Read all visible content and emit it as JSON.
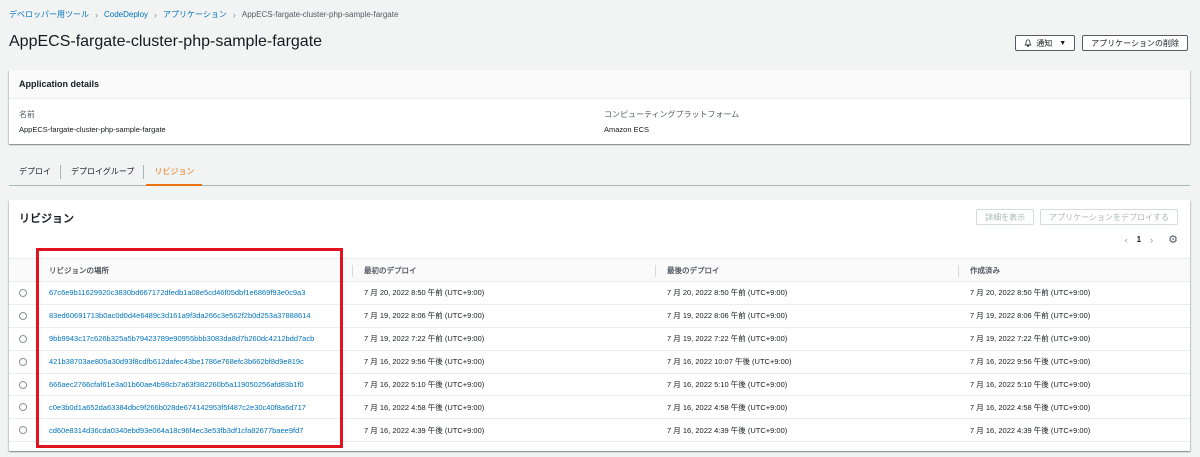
{
  "breadcrumb": {
    "items": [
      "デベロッパー用ツール",
      "CodeDeploy",
      "アプリケーション"
    ],
    "current": "AppECS-fargate-cluster-php-sample-fargate"
  },
  "page": {
    "title": "AppECS-fargate-cluster-php-sample-fargate",
    "notify_label": "通知",
    "delete_label": "アプリケーションの削除"
  },
  "details": {
    "header": "Application details",
    "name_label": "名前",
    "name_value": "AppECS-fargate-cluster-php-sample-fargate",
    "platform_label": "コンピューティングプラットフォーム",
    "platform_value": "Amazon ECS"
  },
  "tabs": [
    "デプロイ",
    "デプロイグループ",
    "リビジョン"
  ],
  "revisions": {
    "title": "リビジョン",
    "view_details_label": "詳細を表示",
    "deploy_label": "アプリケーションをデプロイする",
    "page_number": "1",
    "columns": [
      "リビジョンの場所",
      "最初のデプロイ",
      "最後のデプロイ",
      "作成済み"
    ],
    "rows": [
      [
        "67c6e9b11629920c3830bd667172dfedb1a08e5cd46f05dbf1e6869f93e0c9a3",
        "7 月 20, 2022 8:50 午前 (UTC+9:00)",
        "7 月 20, 2022 8:50 午前 (UTC+9:00)",
        "7 月 20, 2022 8:50 午前 (UTC+9:00)"
      ],
      [
        "83ed60691713b0ac0d0d4e6489c3d161a9f3da266c3e562f2b0d253a37888614",
        "7 月 19, 2022 8:06 午前 (UTC+9:00)",
        "7 月 19, 2022 8:06 午前 (UTC+9:00)",
        "7 月 19, 2022 8:06 午前 (UTC+9:00)"
      ],
      [
        "9bb9943c17c626b325a5b79423789e90955bbb3083da8d7b260dc4212bdd7acb",
        "7 月 19, 2022 7:22 午前 (UTC+9:00)",
        "7 月 19, 2022 7:22 午前 (UTC+9:00)",
        "7 月 19, 2022 7:22 午前 (UTC+9:00)"
      ],
      [
        "421b38703ae805a30d93f8cdfb612dafec43be1786e768efc3b662bf8d9e819c",
        "7 月 16, 2022 9:56 午後 (UTC+9:00)",
        "7 月 16, 2022 10:07 午後 (UTC+9:00)",
        "7 月 16, 2022 9:56 午後 (UTC+9:00)"
      ],
      [
        "666aec2766cfaf61e3a01b60ae4b98cb7a63f382260b5a119050256afd83b1f0",
        "7 月 16, 2022 5:10 午後 (UTC+9:00)",
        "7 月 16, 2022 5:10 午後 (UTC+9:00)",
        "7 月 16, 2022 5:10 午後 (UTC+9:00)"
      ],
      [
        "c0e3b0d1a652da63384dbc9f266b028de674142953f5f487c2e30c40f8a6d717",
        "7 月 16, 2022 4:58 午後 (UTC+9:00)",
        "7 月 16, 2022 4:58 午後 (UTC+9:00)",
        "7 月 16, 2022 4:58 午後 (UTC+9:00)"
      ],
      [
        "cd60e8314d36cda0340ebd93e064a18c96f4ec3e53fb3df1cfa82677baee9fd7",
        "7 月 16, 2022 4:39 午後 (UTC+9:00)",
        "7 月 16, 2022 4:39 午後 (UTC+9:00)",
        "7 月 16, 2022 4:39 午後 (UTC+9:00)"
      ]
    ]
  },
  "colors": {
    "link": "#0073bb",
    "active_tab": "#ec7211",
    "highlight": "#e0141e"
  }
}
